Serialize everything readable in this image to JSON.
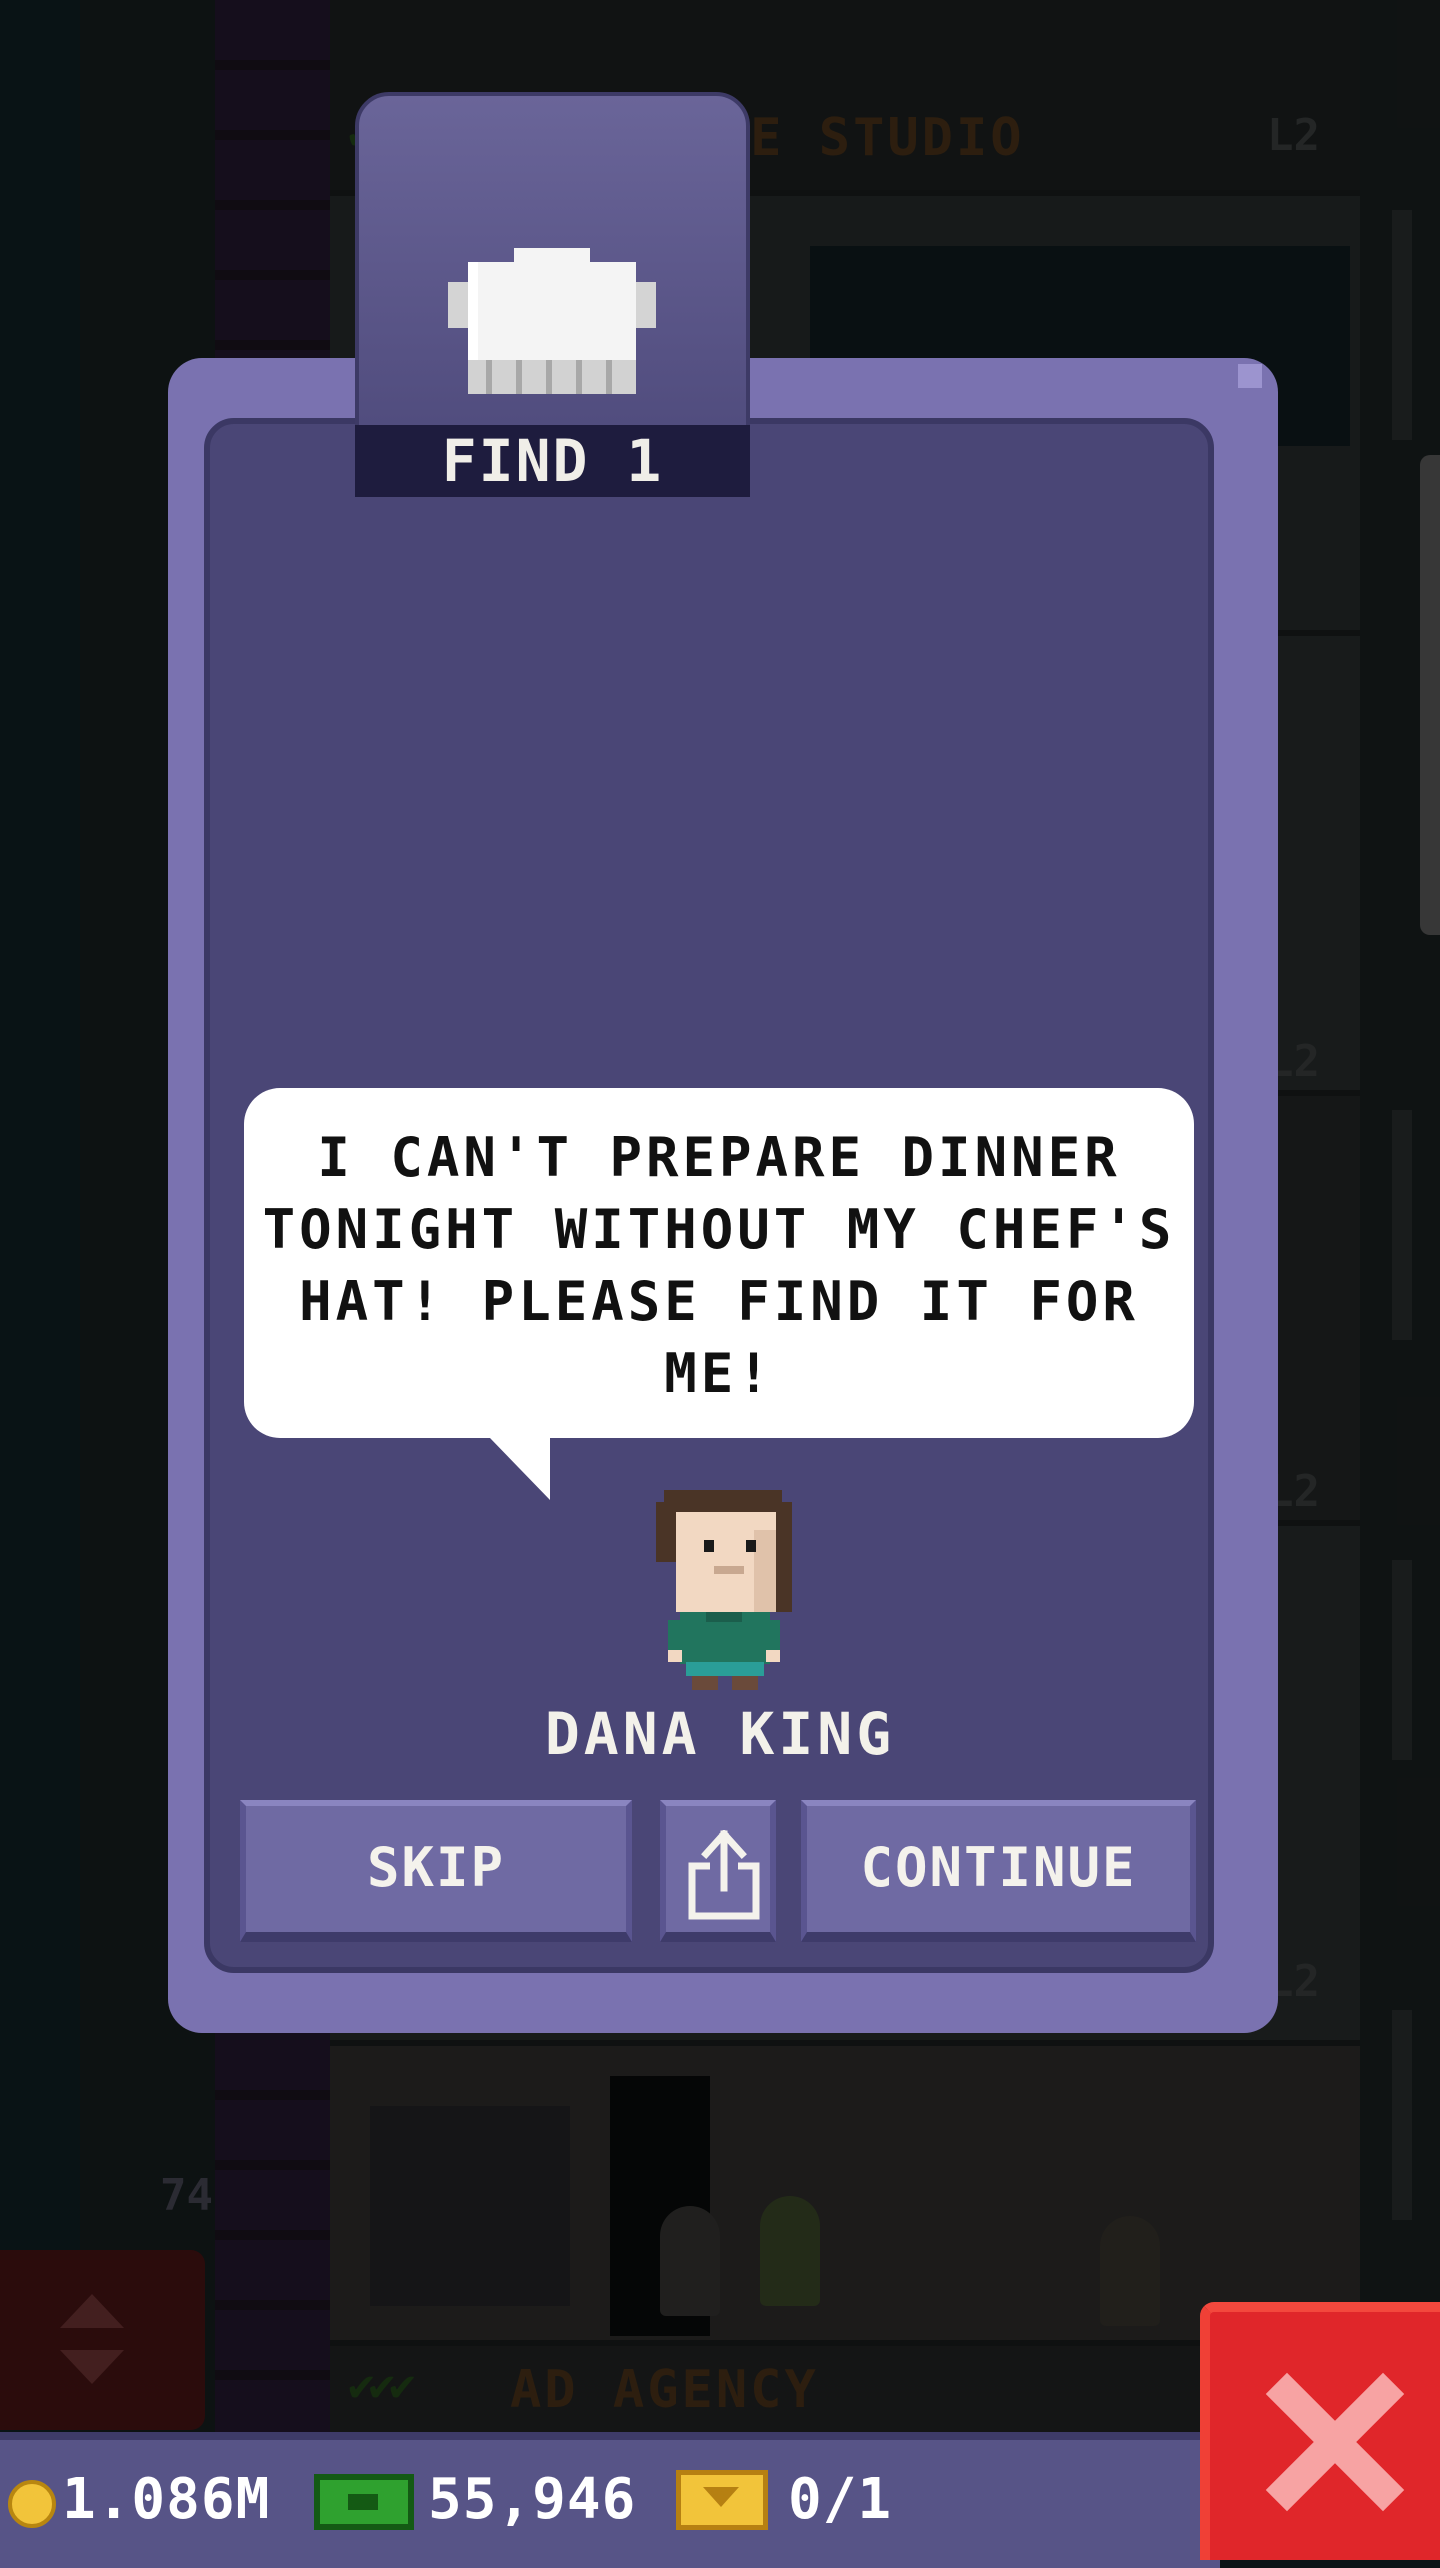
{
  "background": {
    "floors": [
      {
        "name": "SOFTWARE STUDIO",
        "checks": "✔✔✔",
        "level": "L2"
      },
      {
        "name": "AD AGENCY",
        "checks": "✔✔✔",
        "level": "L2"
      }
    ],
    "side_levels": [
      "L2",
      "L2",
      "L2",
      "L2"
    ],
    "shaft_number": "74"
  },
  "mission": {
    "item_label": "FIND 1",
    "item_icon": "chef-hat-icon",
    "speech": "I CAN'T PREPARE DINNER TONIGHT WITHOUT MY CHEF'S HAT! PLEASE FIND IT FOR ME!",
    "character_name": "DANA KING"
  },
  "buttons": {
    "skip": "SKIP",
    "share_icon": "share-icon",
    "continue": "CONTINUE"
  },
  "hud": {
    "coins": "1.086M",
    "bux": "55,946",
    "tickets": "0/1"
  },
  "colors": {
    "modal_outer": "#7a72b0",
    "modal_inner": "#4a4676",
    "button": "#6f6aa3",
    "close_button": "#e0262a"
  }
}
